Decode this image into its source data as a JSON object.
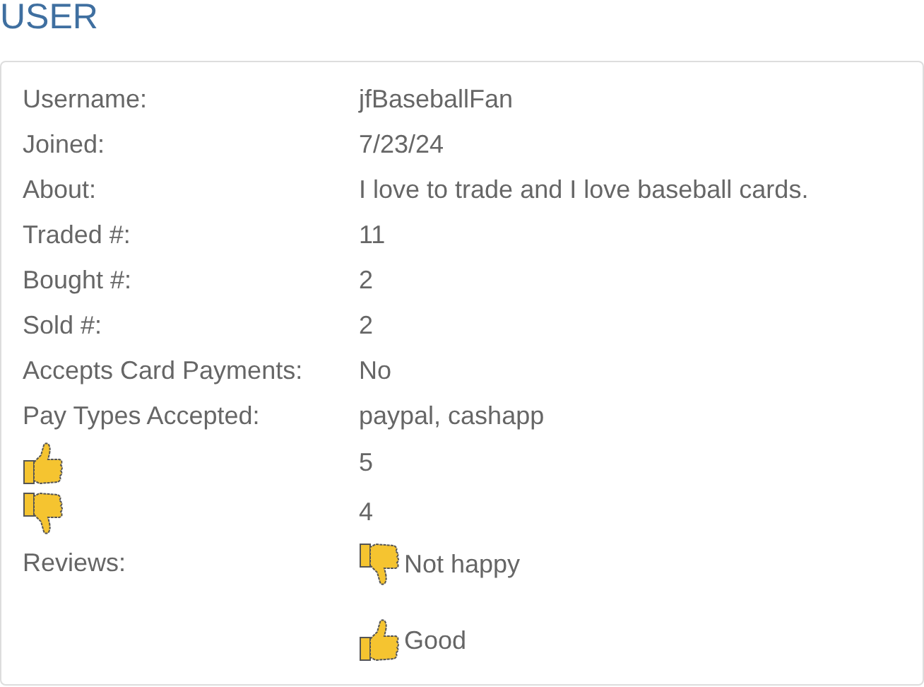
{
  "title": "USER",
  "fields": [
    {
      "label": "Username:",
      "value": "jfBaseballFan"
    },
    {
      "label": "Joined:",
      "value": "7/23/24"
    },
    {
      "label": "About:",
      "value": "I love to trade and I love baseball cards."
    },
    {
      "label": "Traded #:",
      "value": "11"
    },
    {
      "label": "Bought #:",
      "value": "2"
    },
    {
      "label": "Sold #:",
      "value": "2"
    },
    {
      "label": "Accepts Card Payments:",
      "value": "No"
    },
    {
      "label": "Pay Types Accepted:",
      "value": "paypal, cashapp"
    }
  ],
  "ratings": [
    {
      "kind": "up",
      "count": "5"
    },
    {
      "kind": "down",
      "count": "4"
    }
  ],
  "reviews": {
    "label": "Reviews:",
    "items": [
      {
        "kind": "down",
        "text": "Not happy"
      },
      {
        "kind": "up",
        "text": "Good"
      }
    ]
  }
}
